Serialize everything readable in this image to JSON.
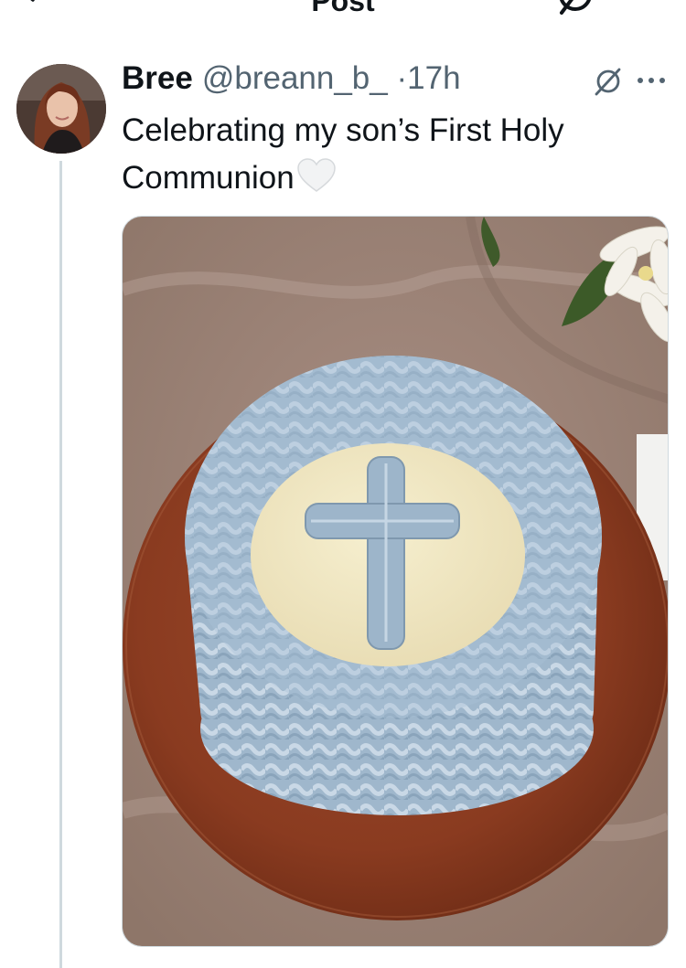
{
  "header": {
    "title": "Post",
    "back_icon": "arrow-left-icon",
    "grok_icon": "grok-icon",
    "more_icon": "more-horizontal-icon"
  },
  "post": {
    "author_name": "Bree",
    "author_handle": "@breann_b_",
    "separator": "·",
    "time": "17h",
    "text": "Celebrating my son’s First Holy Communion",
    "emoji": "white-heart-icon",
    "media": {
      "subject": "cake-photo"
    }
  },
  "colors": {
    "text": "#0f1419",
    "secondary": "#536471",
    "divider": "#cfd9de",
    "frosting_blue": "#a9c1d6"
  }
}
